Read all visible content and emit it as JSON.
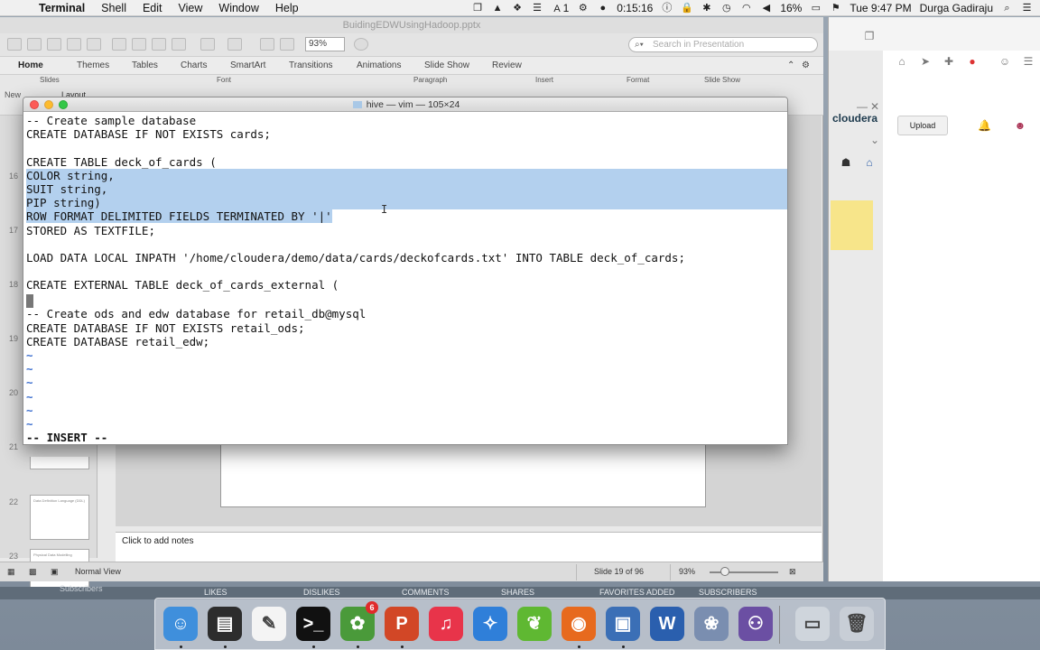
{
  "menubar": {
    "apple": "",
    "items": [
      "Terminal",
      "Shell",
      "Edit",
      "View",
      "Window",
      "Help"
    ],
    "status": {
      "timer": "0:15:16",
      "battery": "16%",
      "datetime": "Tue 9:47 PM",
      "user": "Durga Gadiraju",
      "notif": "1"
    }
  },
  "ppt": {
    "title": "BuidingEDWUsingHadoop.pptx",
    "zoom": "93%",
    "search_placeholder": "Search in Presentation",
    "ribbon_tabs": [
      "Home",
      "Themes",
      "Tables",
      "Charts",
      "SmartArt",
      "Transitions",
      "Animations",
      "Slide Show",
      "Review"
    ],
    "groups": [
      "Slides",
      "Font",
      "Paragraph",
      "Insert",
      "Format",
      "Slide Show"
    ],
    "new_label": "New",
    "layout_label": "Layout",
    "thumb_numbers": [
      "16",
      "17",
      "18",
      "19",
      "20",
      "21",
      "22",
      "23"
    ],
    "thumb_22_title": "Data Definition Language (DDL)",
    "thumb_23_title": "Physical Data Modelling",
    "notes_placeholder": "Click to add notes",
    "status": {
      "view": "Normal View",
      "slide": "Slide 19 of 96",
      "zoom": "93%"
    }
  },
  "browser": {
    "brand": "cloudera",
    "upload": "Upload"
  },
  "terminal": {
    "title": "hive — vim — 105×24",
    "lines": [
      {
        "text": "-- Create sample database",
        "style": ""
      },
      {
        "text": "CREATE DATABASE IF NOT EXISTS cards;",
        "style": ""
      },
      {
        "text": "",
        "style": ""
      },
      {
        "text": "CREATE TABLE deck_of_cards (",
        "style": ""
      },
      {
        "text": "COLOR string,",
        "style": "hl"
      },
      {
        "text": "SUIT string,",
        "style": "hl"
      },
      {
        "text": "PIP string)",
        "style": "hl"
      },
      {
        "text": "ROW FORMAT DELIMITED FIELDS TERMINATED BY '|'",
        "style": "part"
      },
      {
        "text": "STORED AS TEXTFILE;",
        "style": ""
      },
      {
        "text": "",
        "style": ""
      },
      {
        "text": "LOAD DATA LOCAL INPATH '/home/cloudera/demo/data/cards/deckofcards.txt' INTO TABLE deck_of_cards;",
        "style": ""
      },
      {
        "text": "",
        "style": ""
      },
      {
        "text": "CREATE EXTERNAL TABLE deck_of_cards_external (",
        "style": ""
      },
      {
        "text": "",
        "style": "cursor"
      },
      {
        "text": "-- Create ods and edw database for retail_db@mysql",
        "style": ""
      },
      {
        "text": "CREATE DATABASE IF NOT EXISTS retail_ods;",
        "style": ""
      },
      {
        "text": "CREATE DATABASE retail_edw;",
        "style": ""
      },
      {
        "text": "~",
        "style": "tilde"
      },
      {
        "text": "~",
        "style": "tilde"
      },
      {
        "text": "~",
        "style": "tilde"
      },
      {
        "text": "~",
        "style": "tilde"
      },
      {
        "text": "~",
        "style": "tilde"
      },
      {
        "text": "~",
        "style": "tilde"
      },
      {
        "text": "-- INSERT --",
        "style": "mode"
      }
    ]
  },
  "stats": [
    "LIKES",
    "DISLIKES",
    "COMMENTS",
    "SHARES",
    "FAVORITES ADDED",
    "SUBSCRIBERS",
    "Subscribers"
  ],
  "dock": {
    "apps": [
      {
        "name": "finder-icon",
        "color": "#3f8fdc",
        "glyph": "☺"
      },
      {
        "name": "activity-monitor-icon",
        "color": "#2d2d2d",
        "glyph": "▤"
      },
      {
        "name": "textedit-icon",
        "color": "#f4f4f4",
        "glyph": "✎"
      },
      {
        "name": "terminal-icon",
        "color": "#111111",
        "glyph": ">_"
      },
      {
        "name": "growl-icon",
        "color": "#4a9a3a",
        "glyph": "✿"
      },
      {
        "name": "powerpoint-icon",
        "color": "#d24726",
        "glyph": "P"
      },
      {
        "name": "itunes-icon",
        "color": "#e8344a",
        "glyph": "♫"
      },
      {
        "name": "safari-icon",
        "color": "#2f7fd9",
        "glyph": "✧"
      },
      {
        "name": "spring-icon",
        "color": "#5fb832",
        "glyph": "❦"
      },
      {
        "name": "firefox-icon",
        "color": "#e76a1e",
        "glyph": "◉"
      },
      {
        "name": "vmware-icon",
        "color": "#3b6fb6",
        "glyph": "▣"
      },
      {
        "name": "word-icon",
        "color": "#2a5fae",
        "glyph": "W"
      },
      {
        "name": "iphoto-icon",
        "color": "#7a8eb0",
        "glyph": "❀"
      },
      {
        "name": "github-icon",
        "color": "#6b4fa3",
        "glyph": "⚇"
      },
      {
        "name": "screenshot-icon",
        "color": "#cfd5dc",
        "glyph": "▭"
      },
      {
        "name": "trash-icon",
        "color": "#c8ced6",
        "glyph": "🗑"
      }
    ],
    "badge": "6"
  }
}
